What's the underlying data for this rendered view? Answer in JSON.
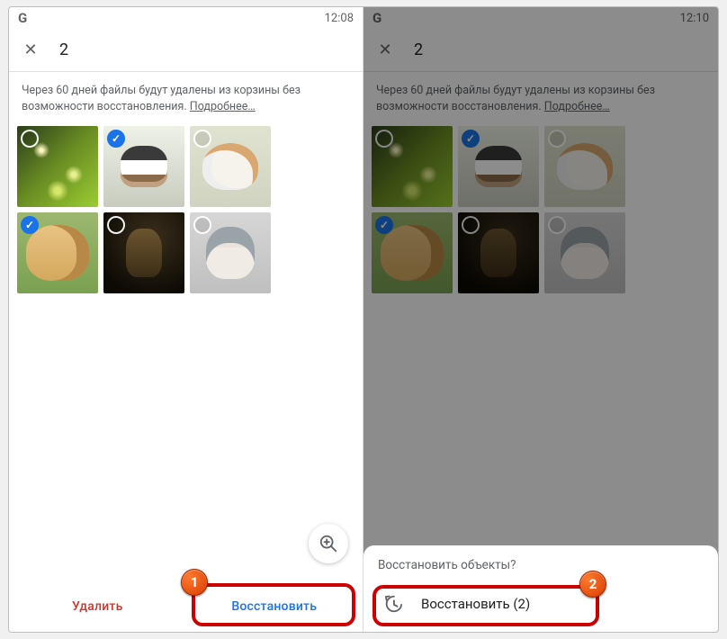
{
  "left": {
    "statusbar": {
      "logo": "G",
      "time": "12:08"
    },
    "appbar": {
      "close": "✕",
      "title": "2"
    },
    "notice": {
      "text": "Через 60 дней файлы будут удалены из корзины без возможности восстановления.",
      "more": "Подробнее…"
    },
    "thumbs": [
      {
        "name": "photo-bokeh",
        "selected": false
      },
      {
        "name": "photo-puppies",
        "selected": true
      },
      {
        "name": "photo-guinea-pig",
        "selected": false
      },
      {
        "name": "photo-golden-retriever",
        "selected": true
      },
      {
        "name": "photo-monkey",
        "selected": false
      },
      {
        "name": "photo-dog-hat",
        "selected": false
      }
    ],
    "actions": {
      "delete": "Удалить",
      "restore": "Восстановить"
    },
    "annotation_badge": "1"
  },
  "right": {
    "statusbar": {
      "logo": "G",
      "time": "12:10"
    },
    "appbar": {
      "close": "✕",
      "title": "2"
    },
    "notice": {
      "text": "Через 60 дней файлы будут удалены из корзины без возможности восстановления.",
      "more": "Подробнее…"
    },
    "sheet": {
      "title": "Восстановить объекты?",
      "action_label": "Восстановить (2)"
    },
    "annotation_badge": "2"
  },
  "icons": {
    "check": "✓",
    "zoom": "⊕"
  }
}
